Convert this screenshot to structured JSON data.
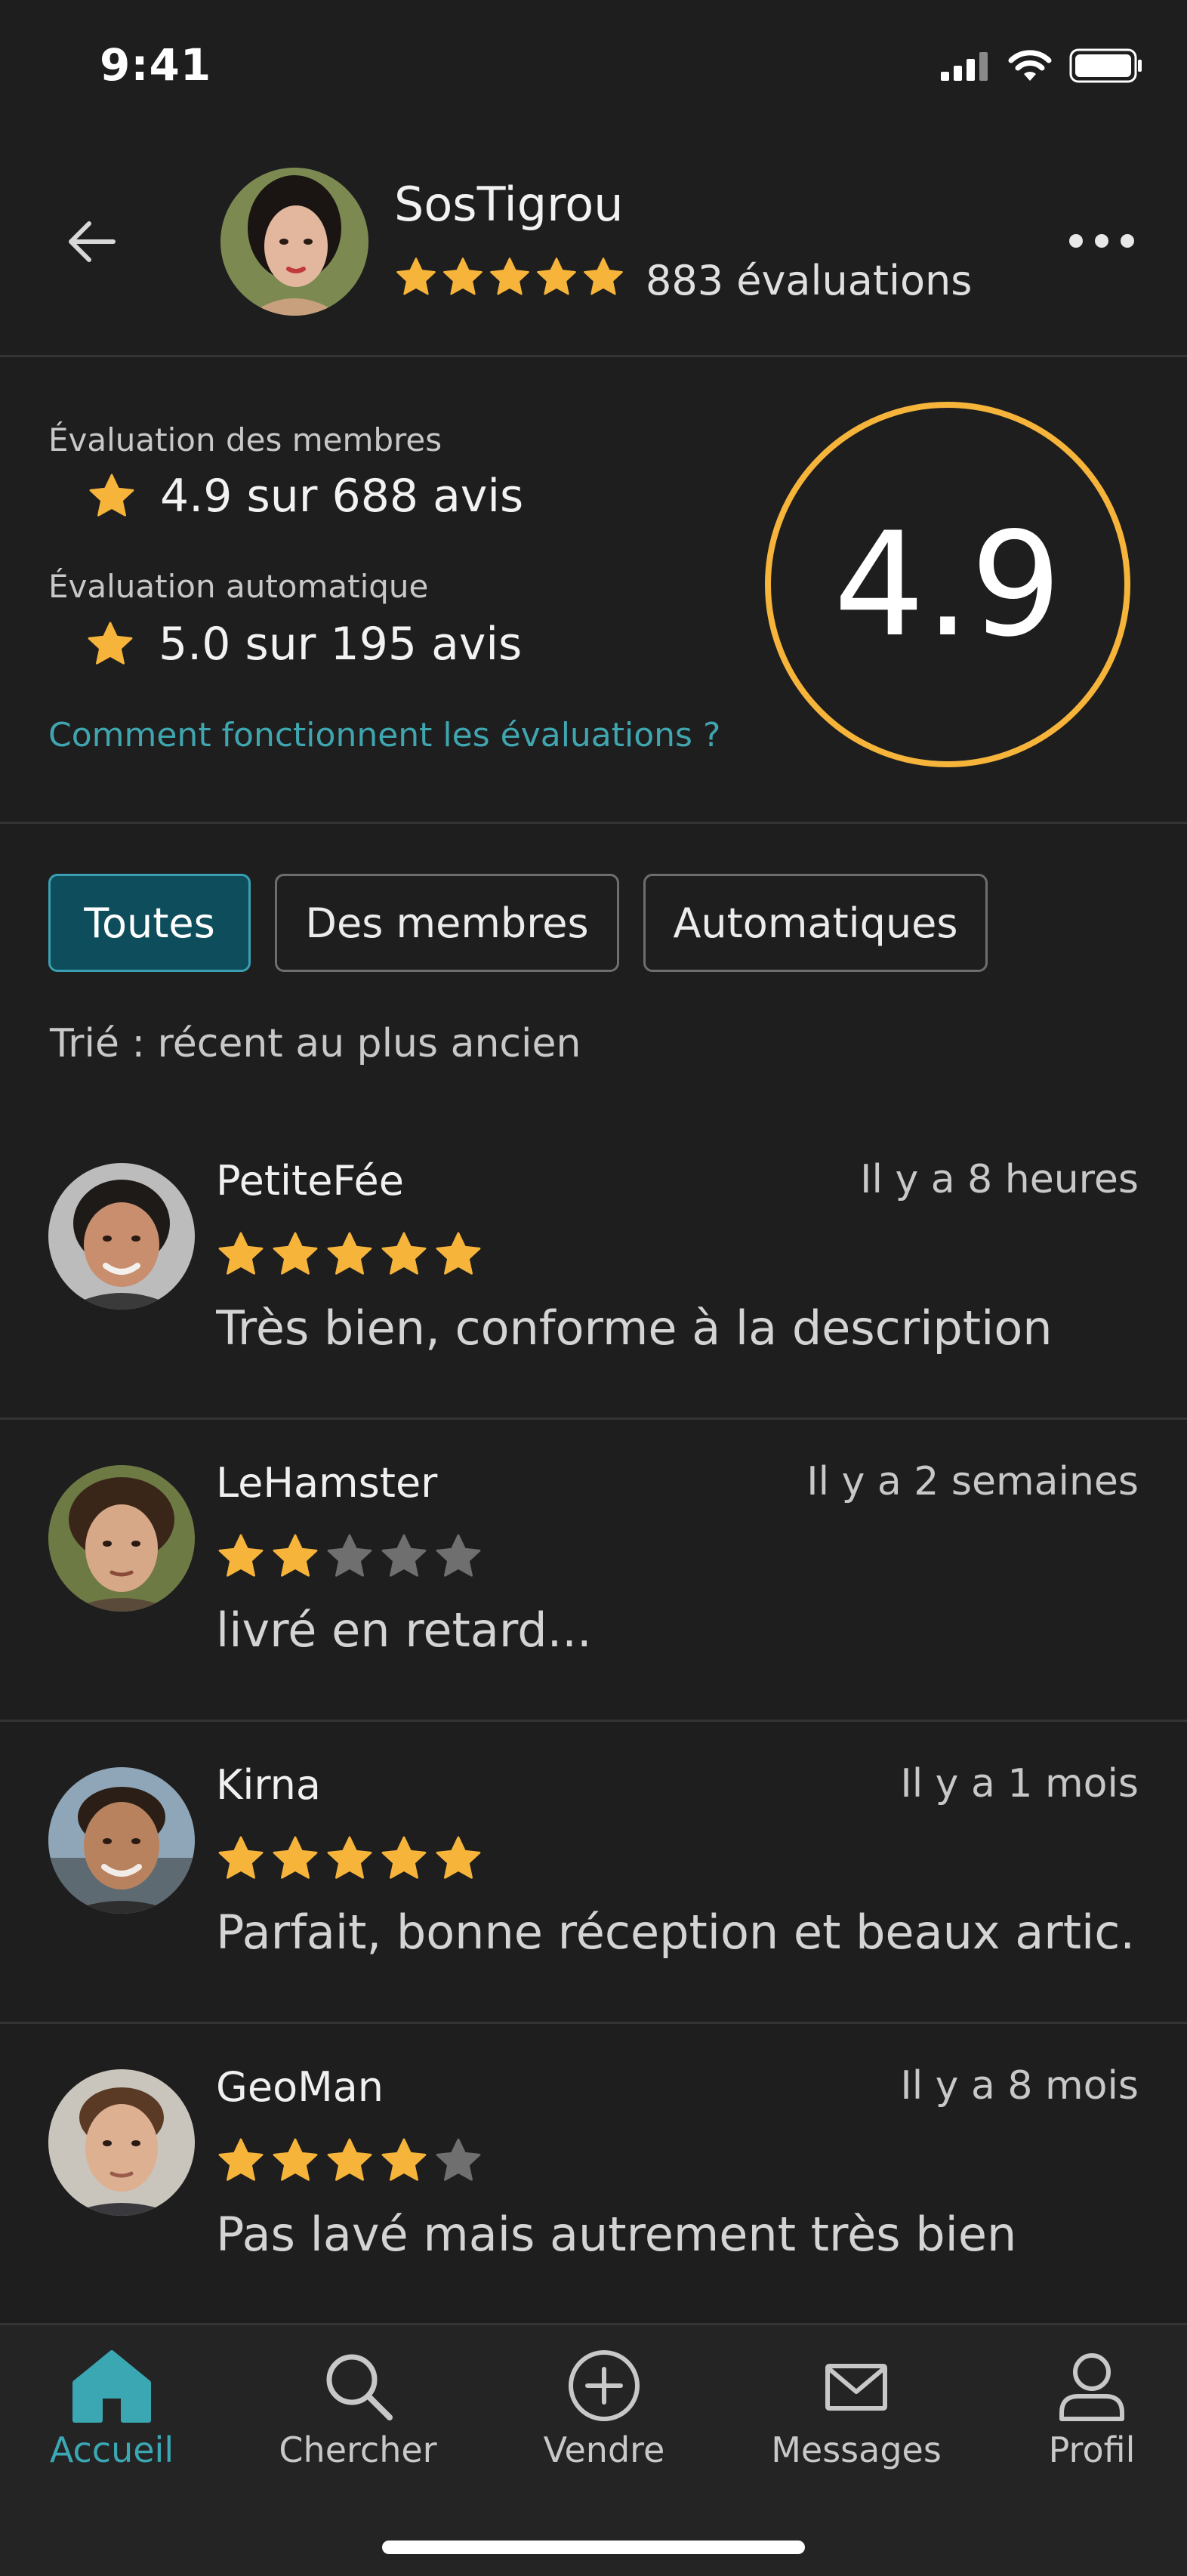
{
  "status_bar": {
    "time": "9:41"
  },
  "header": {
    "username": "SosTigrou",
    "rating_stars": 5,
    "reviews_count_text": "883 évaluations"
  },
  "summary": {
    "member_label": "Évaluation des membres",
    "member_value": "4.9 sur 688 avis",
    "auto_label": "Évaluation automatique",
    "auto_value": "5.0 sur 195 avis",
    "how_link": "Comment fonctionnent les évaluations ?",
    "overall": "4.9",
    "accent_color": "#f6b43a"
  },
  "filters": {
    "tabs": [
      {
        "label": "Toutes",
        "active": true
      },
      {
        "label": "Des membres",
        "active": false
      },
      {
        "label": "Automatiques",
        "active": false
      }
    ],
    "sort_label": "Trié : récent au plus ancien"
  },
  "reviews": [
    {
      "name": "PetiteFée",
      "time": "Il y a 8 heures",
      "stars": 5,
      "text": "Très bien, conforme à la description"
    },
    {
      "name": "LeHamster",
      "time": "Il y a 2 semaines",
      "stars": 2,
      "text": "livré en retard..."
    },
    {
      "name": "Kirna",
      "time": "Il y a 1 mois",
      "stars": 5,
      "text": "Parfait, bonne réception et beaux artic..."
    },
    {
      "name": "GeoMan",
      "time": "Il y a 8 mois",
      "stars": 4,
      "text": "Pas lavé mais autrement très bien"
    }
  ],
  "tabbar": {
    "items": [
      {
        "label": "Accueil",
        "icon": "home-icon",
        "active": true
      },
      {
        "label": "Chercher",
        "icon": "search-icon",
        "active": false
      },
      {
        "label": "Vendre",
        "icon": "plus-circle-icon",
        "active": false
      },
      {
        "label": "Messages",
        "icon": "mail-icon",
        "active": false
      },
      {
        "label": "Profil",
        "icon": "user-icon",
        "active": false
      }
    ]
  },
  "colors": {
    "background": "#1e1e1e",
    "star_filled": "#f6b43a",
    "star_empty": "#6f6f6f",
    "link": "#3fa6b0",
    "active_chip": "#0d4d5c"
  }
}
